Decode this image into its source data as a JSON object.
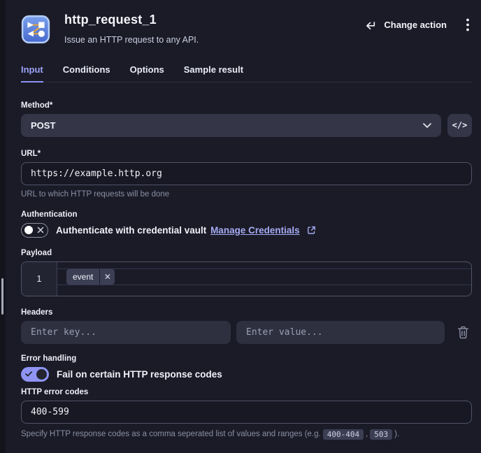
{
  "header": {
    "title": "http_request_1",
    "subtitle": "Issue an HTTP request to any API.",
    "change_action": "Change action"
  },
  "tabs": [
    {
      "label": "Input",
      "active": true
    },
    {
      "label": "Conditions",
      "active": false
    },
    {
      "label": "Options",
      "active": false
    },
    {
      "label": "Sample result",
      "active": false
    }
  ],
  "method": {
    "label": "Method*",
    "value": "POST",
    "code_button": "</>"
  },
  "url": {
    "label": "URL*",
    "value": "https://example.http.org",
    "helper": "URL to which HTTP requests will be done"
  },
  "authentication": {
    "label": "Authentication",
    "toggle_state": "off",
    "text": "Authenticate with credential vault",
    "link_label": "Manage Credentials"
  },
  "payload": {
    "label": "Payload",
    "line_number": "1",
    "pill_text": "event",
    "pill_close": "✕"
  },
  "headers": {
    "label": "Headers",
    "key_placeholder": "Enter key...",
    "value_placeholder": "Enter value..."
  },
  "error_handling": {
    "label": "Error handling",
    "toggle_state": "on",
    "text": "Fail on certain HTTP response codes"
  },
  "http_error_codes": {
    "label": "HTTP error codes",
    "value": "400-599",
    "helper_prefix": "Specify HTTP response codes as a comma seperated list of values and ranges (e.g.",
    "example_code_1": "400-404",
    "separator": ",",
    "example_code_2": "503",
    "helper_suffix": ")."
  },
  "colors": {
    "panel_bg": "#1a1b27",
    "input_filled_bg": "#343648",
    "input_border": "#515468",
    "accent_toggle_on": "#8f94f3",
    "link": "#a6aaf2",
    "active_tab": "#9ba2f6",
    "helper_text": "#8b8fa4",
    "app_icon_blue": "#5d85e0"
  }
}
